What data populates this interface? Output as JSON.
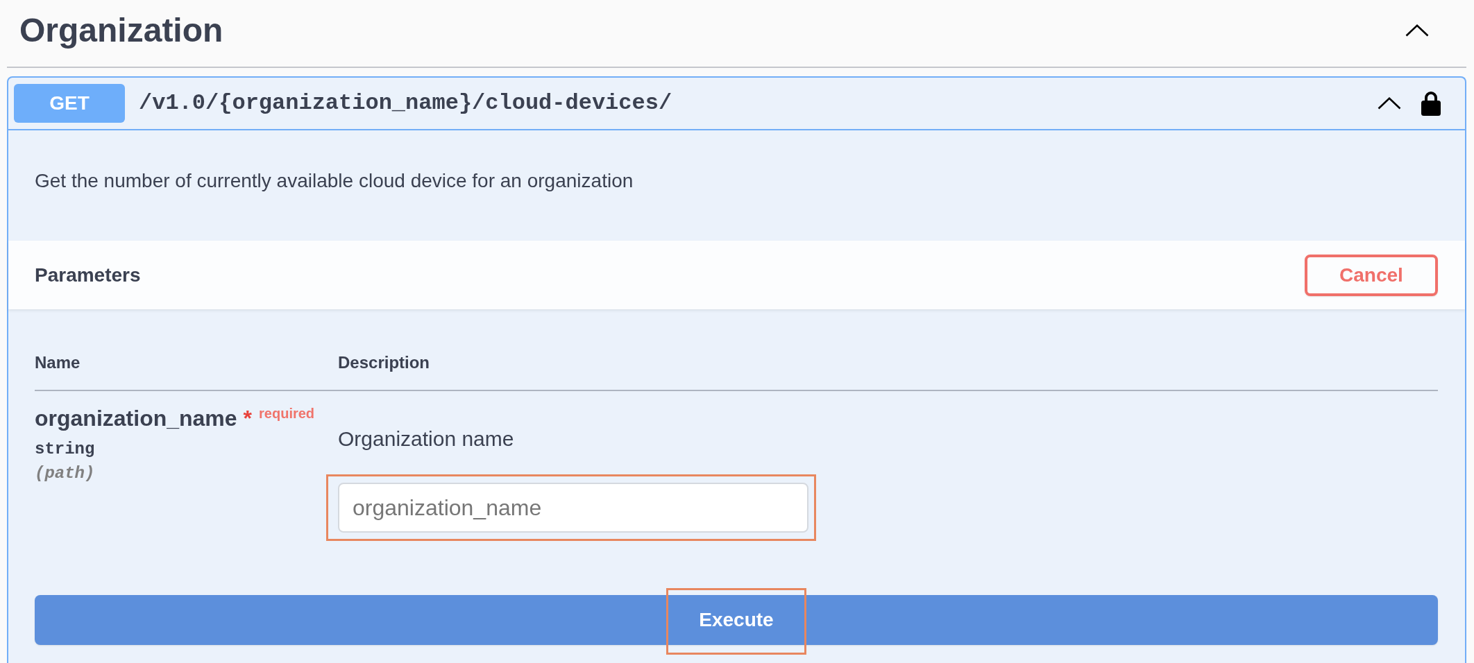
{
  "section": {
    "title": "Organization",
    "expanded": true
  },
  "operation": {
    "method": "GET",
    "path": "/v1.0/{organization_name}/cloud-devices/",
    "expanded": true,
    "locked": true,
    "description": "Get the number of currently available cloud device for an organization"
  },
  "parameters": {
    "title": "Parameters",
    "cancel_button": "Cancel",
    "columns": [
      "Name",
      "Description"
    ],
    "rows": [
      {
        "name": "organization_name",
        "required_mark": "*",
        "required_label": "required",
        "type": "string",
        "location": "(path)",
        "description": "Organization name",
        "input": {
          "placeholder": "organization_name",
          "highlighted": true
        }
      }
    ]
  },
  "execute_button": {
    "label": "Execute",
    "highlighted": true
  }
}
